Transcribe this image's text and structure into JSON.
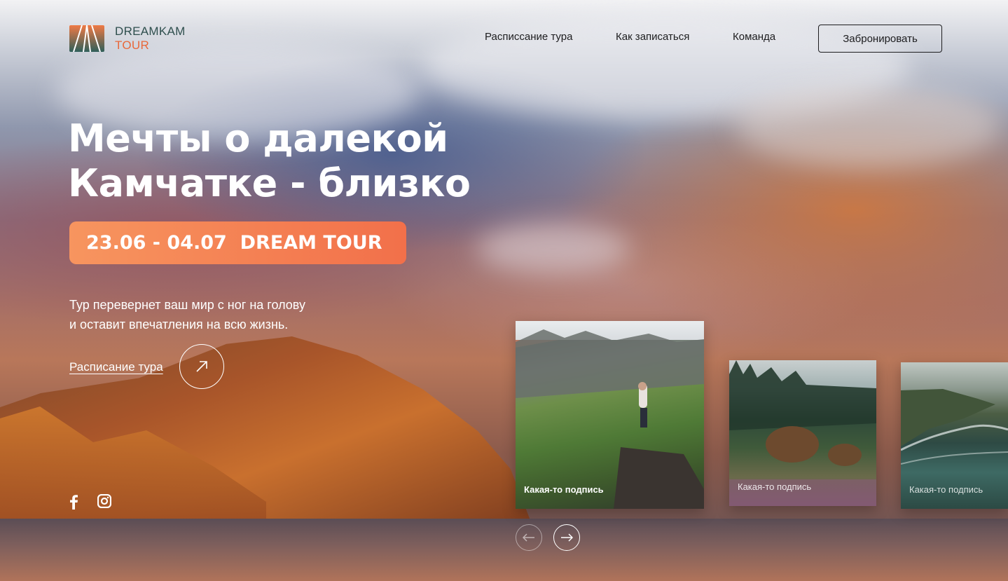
{
  "brand": {
    "line1": "DREAMKAM",
    "line2": "TOUR",
    "accent": "#e8683a",
    "dark": "#2f4f4e"
  },
  "nav": {
    "items": [
      "Расписсание тура",
      "Как записаться",
      "Команда"
    ],
    "cta": "Забронировать"
  },
  "hero": {
    "title_line1": "Мечты о далекой",
    "title_line2": "Камчатке - близко",
    "badge": "23.06 - 04.07  DREAM TOUR",
    "desc_line1": "Тур перевернет ваш мир с ног на голову",
    "desc_line2": "и оставит впечатления на всю жизнь.",
    "link": "Расписание тура",
    "link_icon": "arrow-up-right-icon"
  },
  "social": [
    "facebook-icon",
    "instagram-icon"
  ],
  "cards": [
    {
      "caption": "Какая-то подпись"
    },
    {
      "caption": "Какая-то подпись"
    },
    {
      "caption": "Какая-то подпись"
    }
  ],
  "carousel": {
    "prev_icon": "arrow-left-icon",
    "next_icon": "arrow-right-icon"
  }
}
